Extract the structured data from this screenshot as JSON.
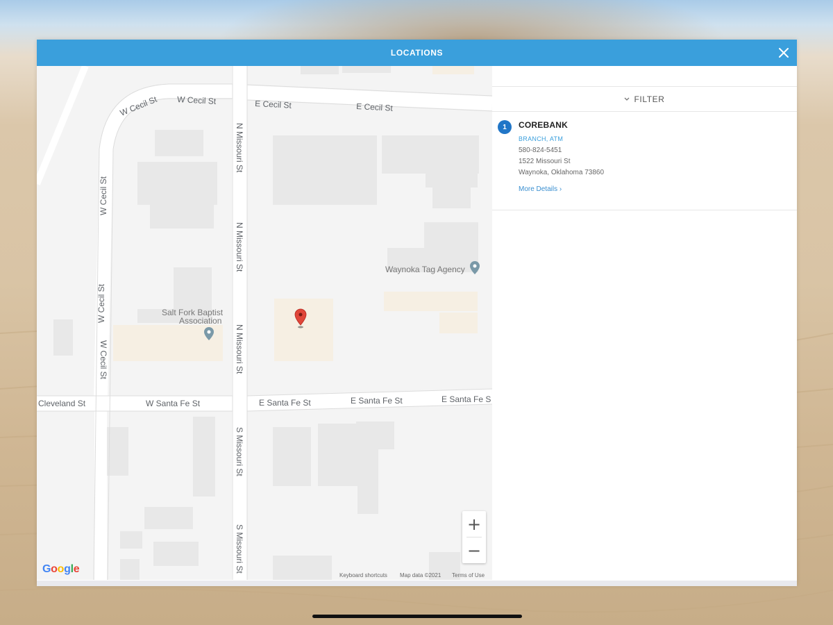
{
  "dialog": {
    "title": "LOCATIONS"
  },
  "map": {
    "streets": {
      "w_cecil_1": "W Cecil St",
      "w_cecil_2": "W Cecil St",
      "e_cecil_1": "E Cecil St",
      "e_cecil_2": "E Cecil St",
      "w_cecil_v1": "W Cecil St",
      "w_cecil_v2": "W Cecil St",
      "w_cecil_v3": "W Cecil St",
      "n_missouri_1": "N Missouri St",
      "n_missouri_2": "N Missouri St",
      "n_missouri_3": "N Missouri St",
      "s_missouri_1": "S Missouri St",
      "s_missouri_2": "S Missouri St",
      "cleveland": "Cleveland St",
      "w_santa_fe": "W Santa Fe St",
      "e_santa_fe_1": "E Santa Fe St",
      "e_santa_fe_2": "E Santa Fe St",
      "e_santa_fe_3": "E Santa Fe S"
    },
    "pois": {
      "tag_agency": "Waynoka Tag Agency",
      "baptist_1": "Salt Fork Baptist",
      "baptist_2": "Association"
    },
    "zoom_in": "+",
    "zoom_out": "−",
    "logo": {
      "G": "G",
      "o1": "o",
      "o2": "o",
      "g": "g",
      "l": "l",
      "e": "e"
    },
    "footer": {
      "shortcuts": "Keyboard shortcuts",
      "map_data": "Map data ©2021",
      "terms": "Terms of Use"
    }
  },
  "filter": {
    "label": "FILTER"
  },
  "results": [
    {
      "index": "1",
      "name": "COREBANK",
      "type": "BRANCH, ATM",
      "phone": "580-824-5451",
      "address1": "1522 Missouri St",
      "address2": "Waynoka, Oklahoma 73860",
      "more": "More Details  ›"
    }
  ],
  "colors": {
    "header": "#3a9fdc",
    "badge": "#2176c7",
    "link": "#3a8fd0",
    "pin": "#e0463a"
  }
}
